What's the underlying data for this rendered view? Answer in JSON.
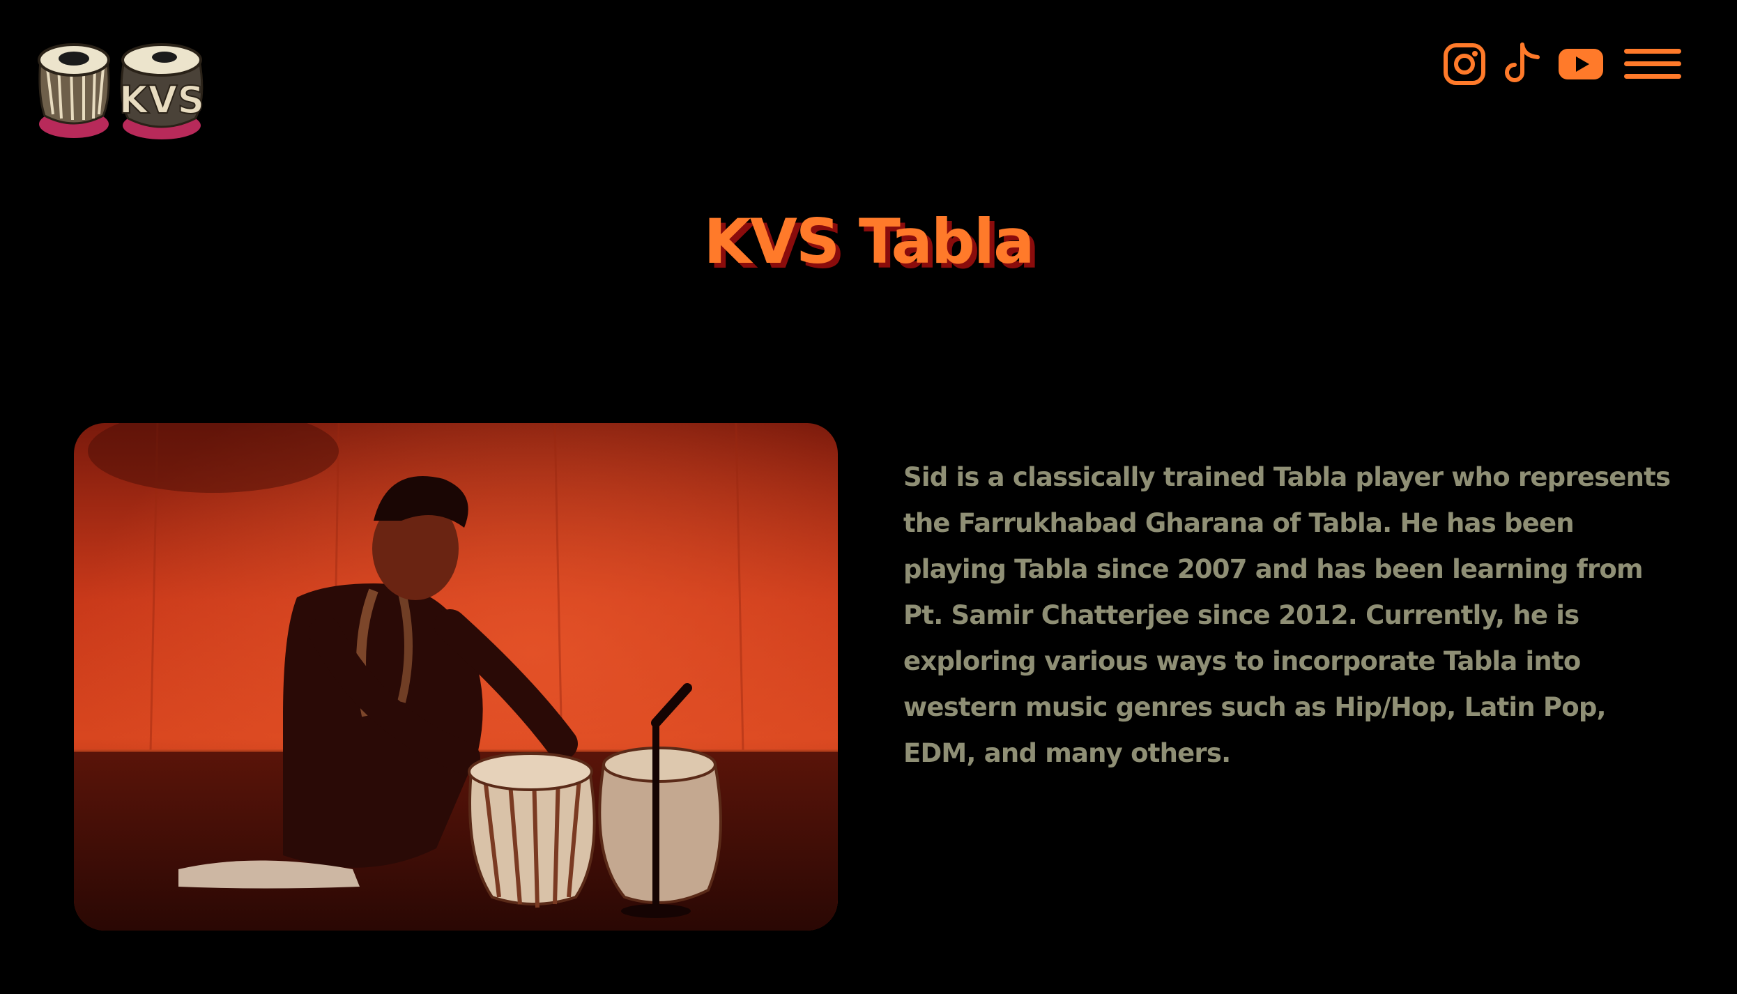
{
  "header": {
    "logo": {
      "text": "KVS",
      "icon": "tabla-drums-logo"
    },
    "social": [
      {
        "name": "instagram",
        "icon": "instagram-icon"
      },
      {
        "name": "tiktok",
        "icon": "tiktok-icon"
      },
      {
        "name": "youtube",
        "icon": "youtube-icon"
      },
      {
        "name": "menu",
        "icon": "hamburger-menu-icon"
      }
    ]
  },
  "main": {
    "title": "KVS Tabla",
    "photo": {
      "subject": "tabla player performing on stage"
    },
    "bio": "Sid is a classically trained Tabla player who represents the Farrukhabad Gharana of Tabla. He has been playing Tabla since 2007 and has been learning from Pt. Samir Chatterjee since 2012. Currently, he is exploring various ways to incorporate Tabla into western music genres such as Hip/Hop, Latin Pop, EDM, and many others."
  },
  "colors": {
    "background": "#000000",
    "accent": "#ff7a2a",
    "title_shadow": "#8a0c0c",
    "body_text": "#8f8f75"
  }
}
